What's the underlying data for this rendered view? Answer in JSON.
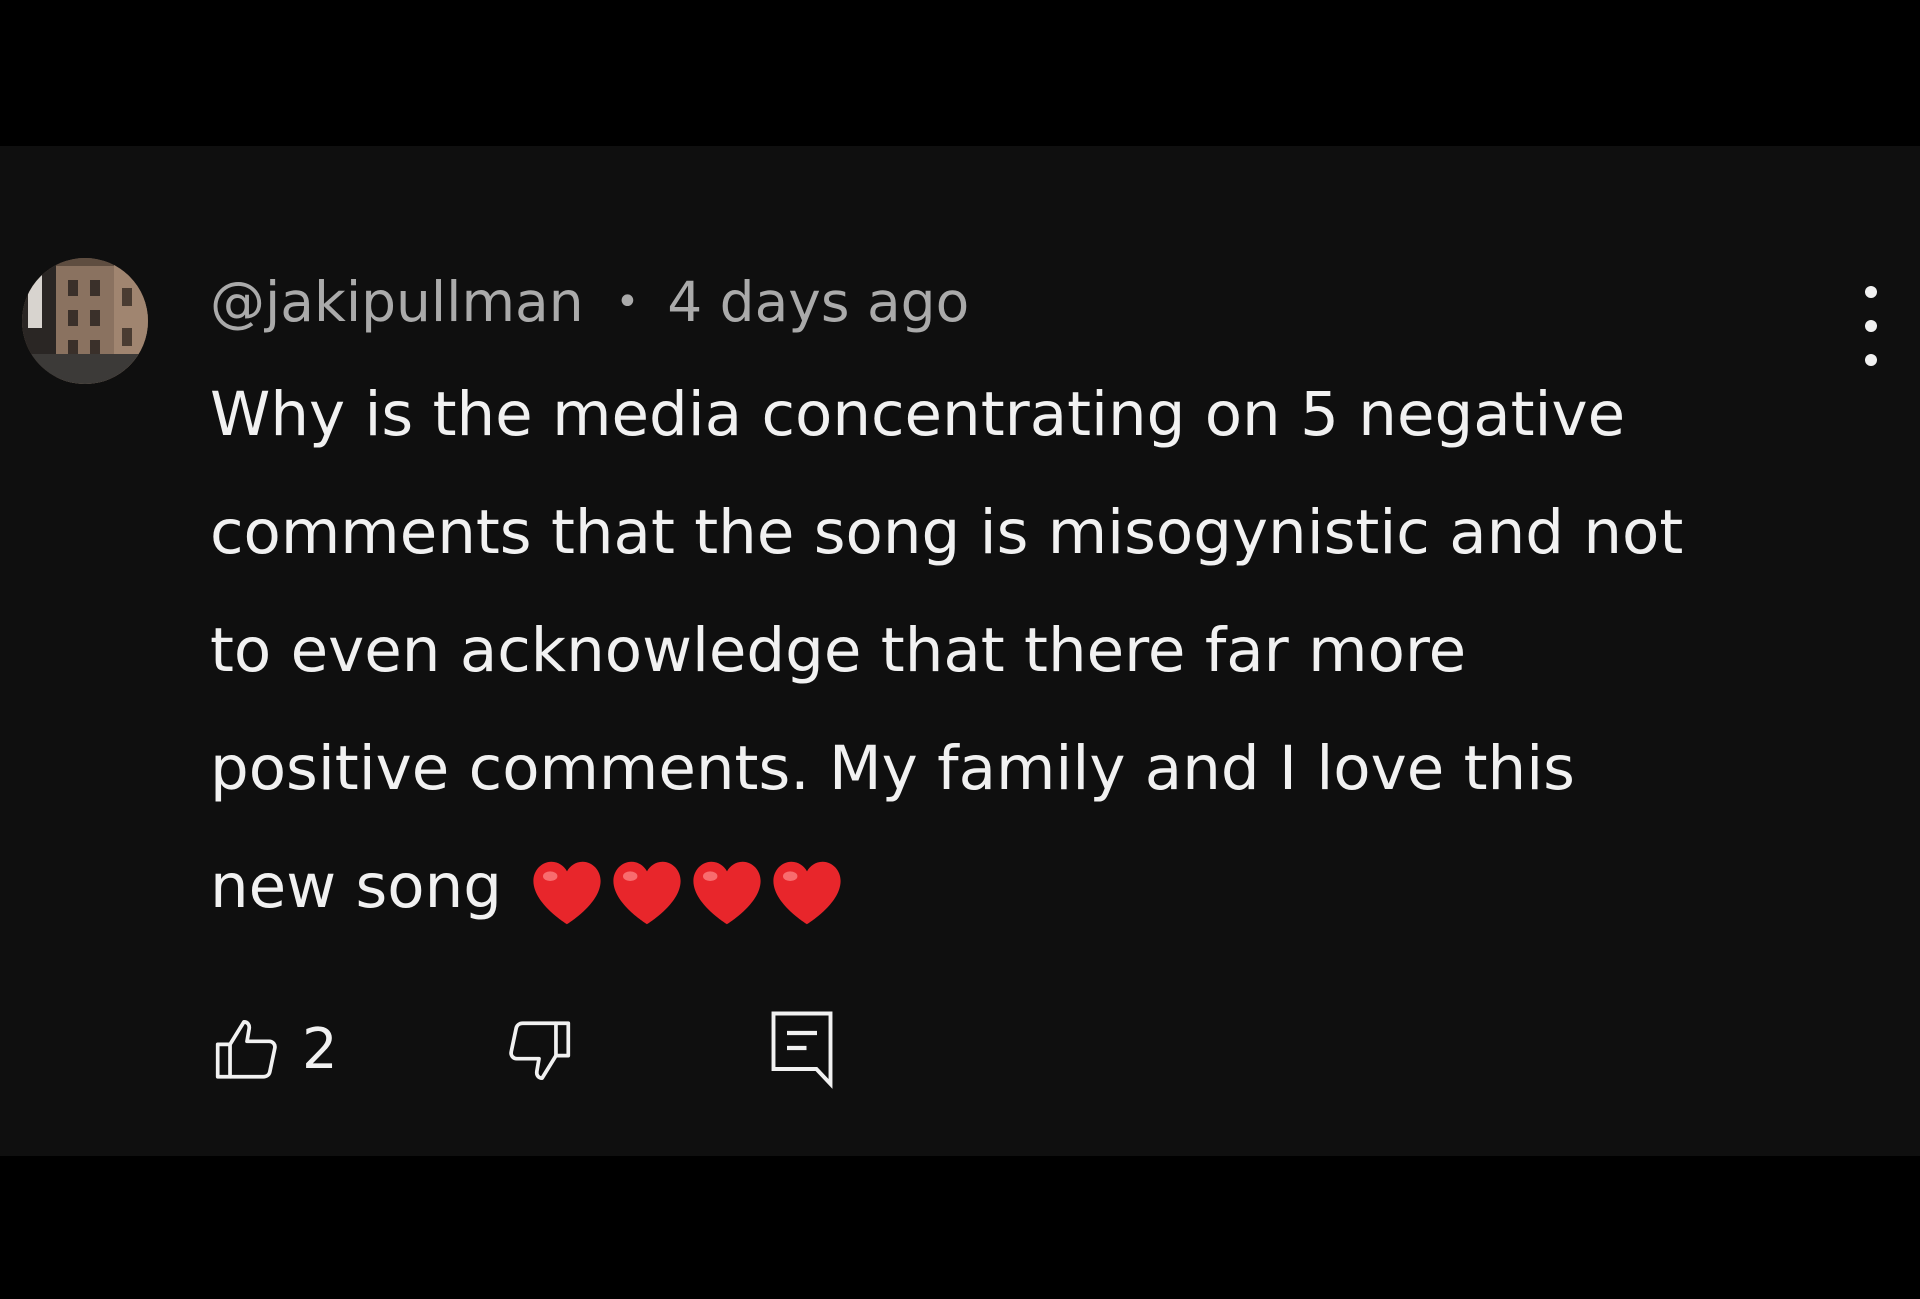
{
  "comment": {
    "author": "@jakipullman",
    "separator": "•",
    "timestamp": "4 days ago",
    "text_lines": [
      "Why is the media concentrating on 5 negative",
      "comments that the song is misogynistic and not",
      "to even acknowledge that there far more",
      "positive comments.  My family and I love this",
      "new song"
    ],
    "heart_count": 4,
    "heart_color": "#e8262b",
    "like_count": "2"
  },
  "icons": {
    "more": "more-vertical-icon",
    "like": "thumbs-up-icon",
    "dislike": "thumbs-down-icon",
    "reply": "comment-reply-icon",
    "heart": "red-heart-emoji"
  },
  "colors": {
    "background": "#000000",
    "panel": "#0f0f0f",
    "text_primary": "#f1f1f1",
    "text_secondary": "#aaaaaa"
  }
}
